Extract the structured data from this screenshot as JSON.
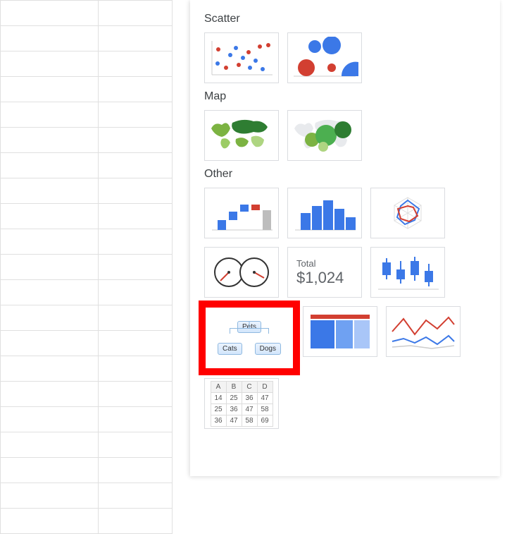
{
  "sections": {
    "scatter": "Scatter",
    "map": "Map",
    "other": "Other"
  },
  "scorecard": {
    "label": "Total",
    "value": "$1,024"
  },
  "org_chart": {
    "root": "Pets",
    "children": [
      "Cats",
      "Dogs"
    ]
  },
  "table_chart": {
    "headers": [
      "A",
      "B",
      "C",
      "D"
    ],
    "rows": [
      [
        "14",
        "25",
        "36",
        "47"
      ],
      [
        "25",
        "36",
        "47",
        "58"
      ],
      [
        "36",
        "47",
        "58",
        "69"
      ]
    ]
  }
}
